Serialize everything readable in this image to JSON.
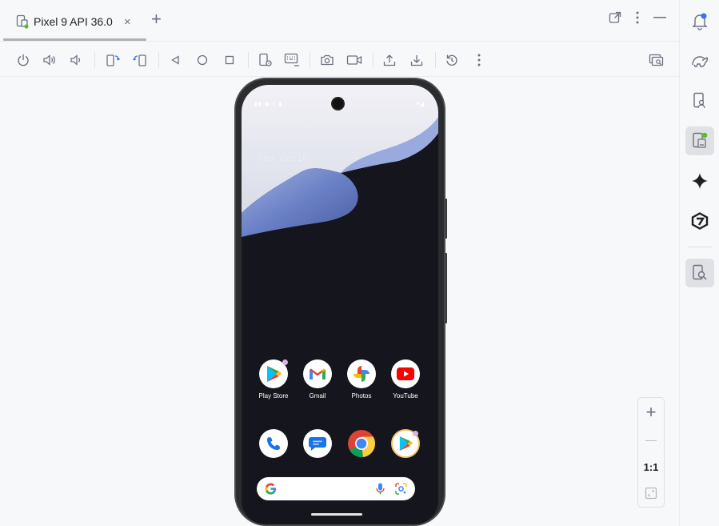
{
  "tab": {
    "title": "Pixel 9 API 36.0",
    "close": "×",
    "add": "+"
  },
  "toolbar": {
    "buttons": [
      "power-icon",
      "volume-up-icon",
      "volume-down-icon",
      "rotate-left-icon",
      "rotate-right-icon",
      "back-icon",
      "home-icon",
      "overview-icon",
      "device-settings-icon",
      "keyboard-icon",
      "screenshot-icon",
      "screen-record-icon",
      "upload-icon",
      "download-icon",
      "reset-icon",
      "more-icon",
      "device-mirror-icon"
    ]
  },
  "device": {
    "date": "Thu, Oct 16",
    "apps_row1": [
      {
        "label": "Play Store",
        "icon": "play-store-icon"
      },
      {
        "label": "Gmail",
        "icon": "gmail-icon"
      },
      {
        "label": "Photos",
        "icon": "photos-icon"
      },
      {
        "label": "YouTube",
        "icon": "youtube-icon"
      }
    ],
    "apps_row2": [
      {
        "icon": "phone-icon"
      },
      {
        "icon": "messages-icon"
      },
      {
        "icon": "chrome-icon"
      },
      {
        "icon": "play-store-alt-icon"
      }
    ]
  },
  "zoom": {
    "in": "+",
    "out": "—",
    "actual": "1:1"
  },
  "colors": {
    "accent": "#3574f0",
    "status_green": "#5fb832"
  }
}
